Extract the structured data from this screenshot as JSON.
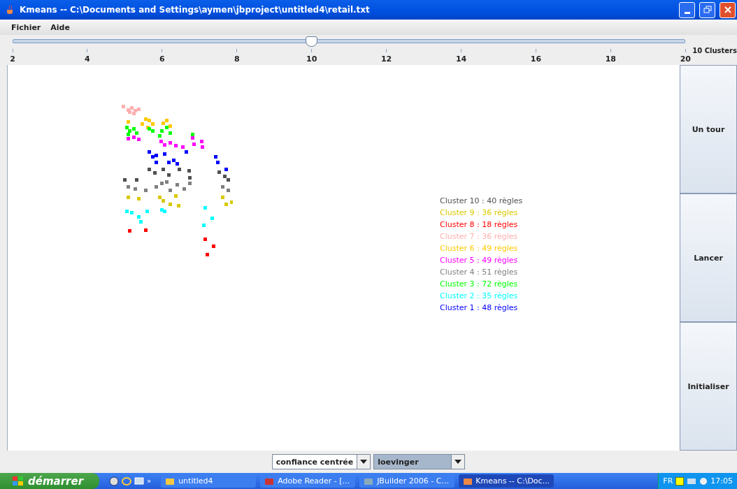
{
  "window": {
    "title": "Kmeans -- C:\\Documents and Settings\\aymen\\jbproject\\untitled4\\retail.txt"
  },
  "menu": [
    "Fichier",
    "Aide"
  ],
  "slider": {
    "level": 0.444,
    "ticks": [
      "2",
      "4",
      "6",
      "8",
      "10",
      "12",
      "14",
      "16",
      "18",
      "20"
    ],
    "reading": "10 Clusters"
  },
  "clusters": [
    {
      "label": "Cluster 10 : 40 règles",
      "color": "#505050"
    },
    {
      "label": "Cluster 9 : 36 règles",
      "color": "#d8c800"
    },
    {
      "label": "Cluster 8 : 18 règles",
      "color": "#ff0000"
    },
    {
      "label": "Cluster 7 : 36 règles",
      "color": "#ffafaf"
    },
    {
      "label": "Cluster 6 : 49 règles",
      "color": "#ffc800"
    },
    {
      "label": "Cluster 5 : 49 règles",
      "color": "#ff00ff"
    },
    {
      "label": "Cluster 4 : 51 règles",
      "color": "#808080"
    },
    {
      "label": "Cluster 3 : 72 règles",
      "color": "#00ff00"
    },
    {
      "label": "Cluster 2 : 35 règles",
      "color": "#00ffff"
    },
    {
      "label": "Cluster 1 : 48 règles",
      "color": "#0000ff"
    }
  ],
  "buttons": [
    "Un tour",
    "Lancer",
    "Initialiser"
  ],
  "combos": [
    {
      "value": "confiance centrée",
      "selected": false
    },
    {
      "value": "loevinger",
      "selected": true
    }
  ],
  "taskbar": {
    "start": "démarrer",
    "more": "»",
    "items": [
      {
        "label": "untitled4",
        "selected": false
      },
      {
        "label": "Adobe Reader - [...",
        "selected": false
      },
      {
        "label": "JBuilder 2006 - C...",
        "selected": false
      },
      {
        "label": "Kmeans -- C:\\Doc...",
        "selected": true
      }
    ],
    "language": "FR",
    "clock": "17:05"
  }
}
